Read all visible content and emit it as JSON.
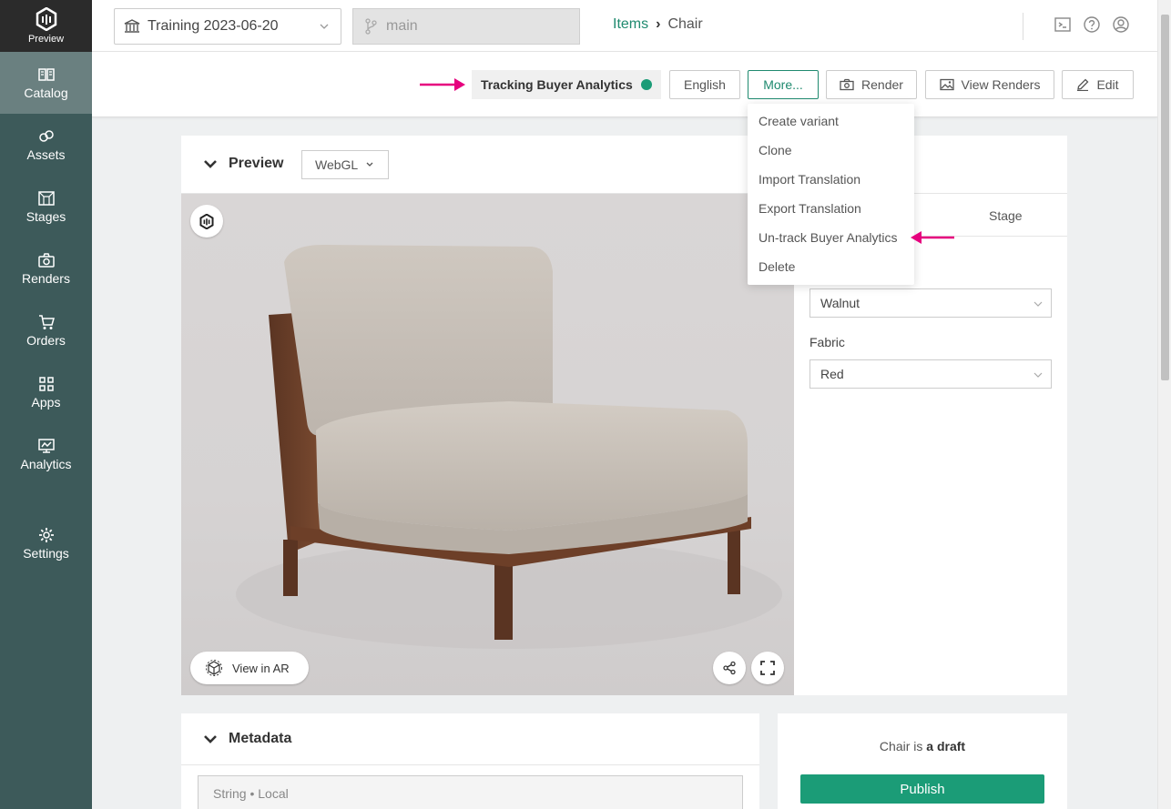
{
  "sidebar": {
    "logo_label": "Preview",
    "items": [
      {
        "label": "Catalog",
        "icon": "book-icon"
      },
      {
        "label": "Assets",
        "icon": "cubes-icon"
      },
      {
        "label": "Stages",
        "icon": "stage-icon"
      },
      {
        "label": "Renders",
        "icon": "camera-icon"
      },
      {
        "label": "Orders",
        "icon": "cart-icon"
      },
      {
        "label": "Apps",
        "icon": "grid-icon"
      },
      {
        "label": "Analytics",
        "icon": "chart-icon"
      },
      {
        "label": "Settings",
        "icon": "gear-icon"
      }
    ]
  },
  "topbar": {
    "workspace": "Training 2023-06-20",
    "branch_placeholder": "main",
    "breadcrumb_link": "Items",
    "breadcrumb_current": "Chair"
  },
  "actions": {
    "tracking_label": "Tracking Buyer Analytics",
    "tracking_color": "#1b9c77",
    "english": "English",
    "more": "More...",
    "render": "Render",
    "view_renders": "View Renders",
    "edit": "Edit"
  },
  "menu": {
    "items": [
      "Create variant",
      "Clone",
      "Import Translation",
      "Export Translation",
      "Un-track Buyer Analytics",
      "Delete"
    ]
  },
  "preview": {
    "title": "Preview",
    "renderer": "WebGL",
    "view_in_ar": "View in AR",
    "tab_stage": "Stage",
    "fields": [
      {
        "value": "Walnut"
      },
      {
        "label": "Fabric",
        "value": "Red"
      }
    ]
  },
  "metadata": {
    "title": "Metadata",
    "field_placeholder": "String • Local"
  },
  "draft": {
    "prefix": "Chair is",
    "status": "a draft",
    "publish": "Publish"
  },
  "colors": {
    "accent": "#1f8a6f",
    "sidebar": "#3d5a5a",
    "arrow": "#e6007e"
  }
}
